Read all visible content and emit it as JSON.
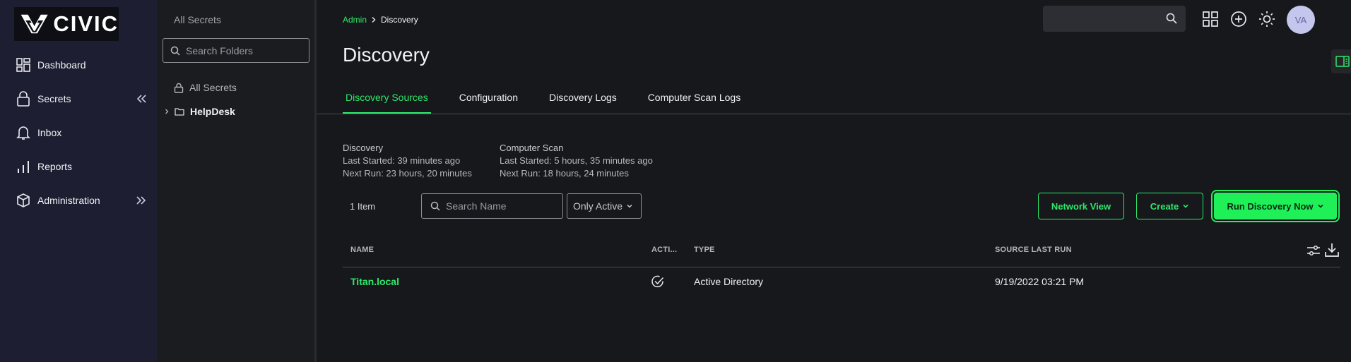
{
  "brand": {
    "name": "CIVIC"
  },
  "nav": {
    "items": [
      {
        "label": "Dashboard",
        "icon": "dashboard-icon"
      },
      {
        "label": "Secrets",
        "icon": "lock-icon"
      },
      {
        "label": "Inbox",
        "icon": "bell-icon"
      },
      {
        "label": "Reports",
        "icon": "bar-chart-icon"
      },
      {
        "label": "Administration",
        "icon": "cube-icon"
      }
    ]
  },
  "folders": {
    "header": "All Secrets",
    "search_placeholder": "Search Folders",
    "tree": [
      {
        "label": "All Secrets",
        "icon": "lock-icon"
      },
      {
        "label": "HelpDesk",
        "icon": "folder-icon"
      }
    ]
  },
  "breadcrumb": {
    "parent": "Admin",
    "current": "Discovery"
  },
  "page": {
    "title": "Discovery"
  },
  "header": {
    "avatar_initials": "VA"
  },
  "tabs": [
    "Discovery Sources",
    "Configuration",
    "Discovery Logs",
    "Computer Scan Logs"
  ],
  "status": {
    "discovery": {
      "title": "Discovery",
      "last_started": "Last Started: 39 minutes ago",
      "next_run": "Next Run: 23 hours, 20 minutes"
    },
    "computer_scan": {
      "title": "Computer Scan",
      "last_started": "Last Started: 5 hours, 35 minutes ago",
      "next_run": "Next Run: 18 hours, 24 minutes"
    }
  },
  "toolbar": {
    "count": "1 Item",
    "search_placeholder": "Search Name",
    "filter": "Only Active",
    "network_view": "Network View",
    "create": "Create",
    "run_discovery": "Run Discovery Now"
  },
  "table": {
    "columns": [
      "NAME",
      "ACTI...",
      "TYPE",
      "SOURCE LAST RUN"
    ],
    "rows": [
      {
        "name": "Titan.local",
        "active": true,
        "type": "Active Directory",
        "source_last_run": "9/19/2022 03:21 PM"
      }
    ]
  },
  "colors": {
    "accent": "#2ee86a",
    "nav_bg": "#1e1e33",
    "page_bg": "#16181b"
  }
}
